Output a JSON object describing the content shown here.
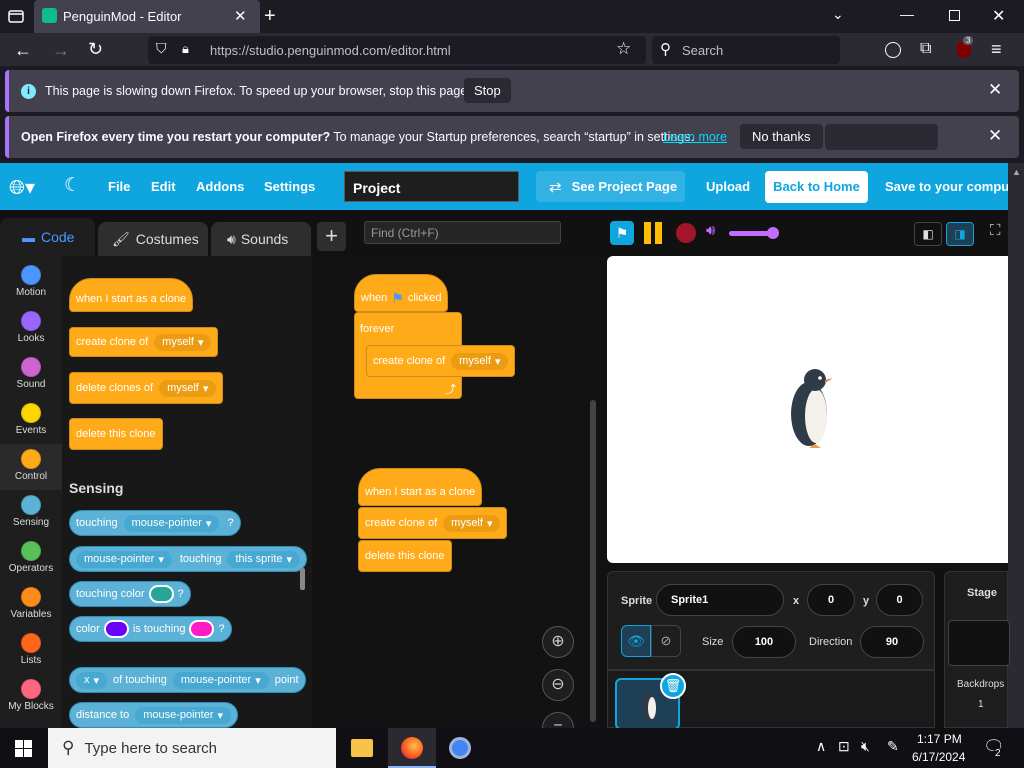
{
  "browser": {
    "tab_title": "PenguinMod - Editor",
    "url": "https://studio.penguinmod.com/editor.html",
    "search_placeholder": "Search",
    "addon_badge": "3"
  },
  "notification1": {
    "text": "This page is slowing down Firefox. To speed up your browser, stop this page.",
    "stop_label": "Stop"
  },
  "notification2": {
    "bold_text": "Open Firefox every time you restart your computer?",
    "text": " To manage your Startup preferences, search “startup” in settings.",
    "learn_more": "Learn more",
    "no_thanks": "No thanks"
  },
  "menubar": {
    "file": "File",
    "edit": "Edit",
    "addons": "Addons",
    "settings": "Settings",
    "project_title": "Project",
    "see_project_page": "See Project Page",
    "upload": "Upload",
    "back_to_home": "Back to Home",
    "save": "Save to your computer"
  },
  "tabs": {
    "code": "Code",
    "costumes": "Costumes",
    "sounds": "Sounds"
  },
  "find_placeholder": "Find (Ctrl+F)",
  "categories": [
    {
      "label": "Motion",
      "color": "#4c97ff"
    },
    {
      "label": "Looks",
      "color": "#9966ff"
    },
    {
      "label": "Sound",
      "color": "#cf63cf"
    },
    {
      "label": "Events",
      "color": "#ffd500"
    },
    {
      "label": "Control",
      "color": "#ffab19"
    },
    {
      "label": "Sensing",
      "color": "#5cb1d6"
    },
    {
      "label": "Operators",
      "color": "#59c059"
    },
    {
      "label": "Variables",
      "color": "#ff8c1a"
    },
    {
      "label": "Lists",
      "color": "#ff661a"
    },
    {
      "label": "My Blocks",
      "color": "#ff6680"
    }
  ],
  "palette": {
    "when_clone": "when I start as a clone",
    "create_clone": "create clone of",
    "delete_clones": "delete clones of",
    "myself": "myself",
    "delete_this": "delete this clone",
    "sensing_header": "Sensing",
    "touching": "touching",
    "mouse_pointer": "mouse-pointer",
    "q": "?",
    "touching2": "touching",
    "this_sprite": "this sprite",
    "touching_color": "touching color",
    "color": "color",
    "is_touching": "is touching",
    "x": "x",
    "of_touching": "of touching",
    "point": "point",
    "distance_to": "distance to"
  },
  "workspace": {
    "when": "when",
    "clicked": "clicked",
    "forever": "forever",
    "create_clone": "create clone of",
    "myself": "myself",
    "when_clone": "when I start as a clone",
    "create_clone2": "create clone of",
    "myself2": "myself",
    "delete_this": "delete this clone"
  },
  "sprite": {
    "label_sprite": "Sprite",
    "name": "Sprite1",
    "label_x": "x",
    "x": "0",
    "label_y": "y",
    "y": "0",
    "label_size": "Size",
    "size": "100",
    "label_direction": "Direction",
    "direction": "90"
  },
  "stage_panel": {
    "title": "Stage",
    "backdrops_label": "Backdrops",
    "backdrops_count": "1"
  },
  "taskbar": {
    "search_placeholder": "Type here to search",
    "time": "1:17 PM",
    "date": "6/17/2024",
    "notif_count": "2"
  }
}
